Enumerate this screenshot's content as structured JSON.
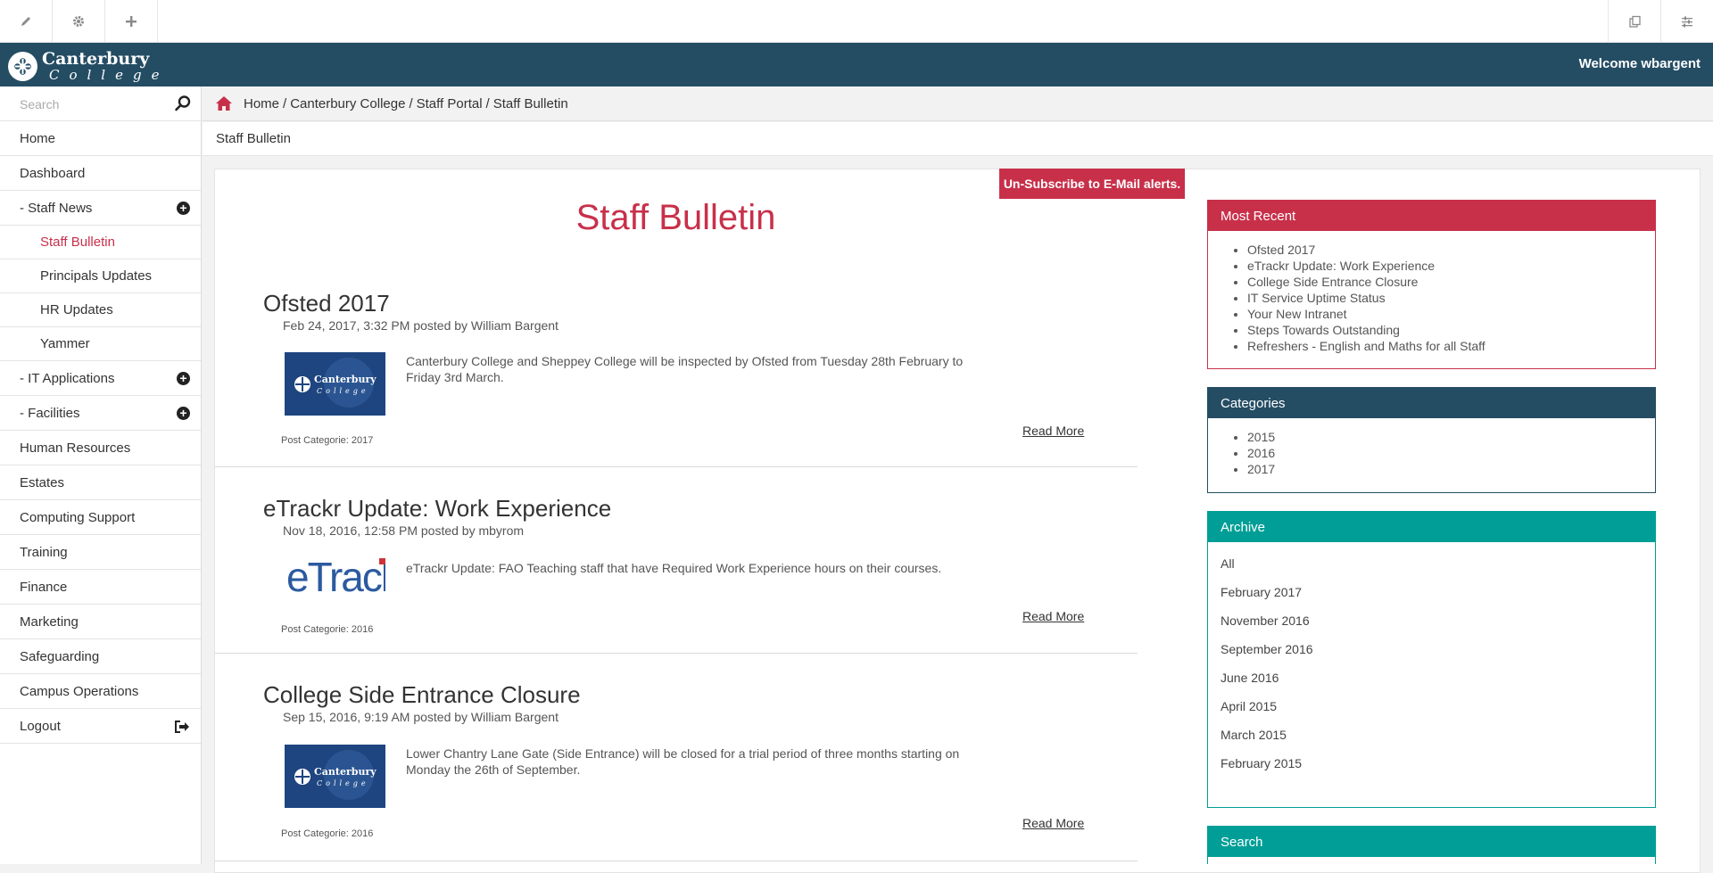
{
  "colors": {
    "header_bg": "#244d64",
    "accent_red": "#c8304a",
    "teal": "#009e96"
  },
  "toolbar": {
    "left_icons": [
      "pencil-icon",
      "gear-icon",
      "plus-icon"
    ],
    "right_icons": [
      "copy-icon",
      "sliders-icon"
    ]
  },
  "header": {
    "brand_line1": "Canterbury",
    "brand_line2": "College",
    "welcome": "Welcome wbargent"
  },
  "sidebar": {
    "search_placeholder": "Search",
    "items": [
      {
        "label": "Home"
      },
      {
        "label": "Dashboard"
      },
      {
        "label": "- Staff News"
      },
      {
        "label": "Staff Bulletin"
      },
      {
        "label": "Principals Updates"
      },
      {
        "label": "HR Updates"
      },
      {
        "label": "Yammer"
      },
      {
        "label": "- IT Applications"
      },
      {
        "label": "- Facilities"
      },
      {
        "label": "Human Resources"
      },
      {
        "label": "Estates"
      },
      {
        "label": "Computing Support"
      },
      {
        "label": "Training"
      },
      {
        "label": "Finance"
      },
      {
        "label": "Marketing"
      },
      {
        "label": "Safeguarding"
      },
      {
        "label": "Campus Operations"
      },
      {
        "label": "Logout"
      }
    ]
  },
  "breadcrumb": {
    "items": [
      "Home",
      "Canterbury College",
      "Staff Portal",
      "Staff Bulletin"
    ],
    "separator": "/"
  },
  "subtitle": "Staff Bulletin",
  "main": {
    "unsubscribe_label": "Un-Subscribe to E-Mail alerts.",
    "title": "Staff Bulletin",
    "read_more": "Read More",
    "posts": [
      {
        "title": "Ofsted 2017",
        "meta": "Feb 24, 2017, 3:32 PM posted by William Bargent",
        "excerpt": "Canterbury College and Sheppey College will be inspected by Ofsted from Tuesday 28th February to Friday 3rd March.",
        "category": "Post Categorie: 2017",
        "thumb": "canterbury-logo"
      },
      {
        "title": "eTrackr Update: Work Experience",
        "meta": "Nov 18, 2016, 12:58 PM posted by mbyrom",
        "excerpt": "eTrackr Update: FAO Teaching staff that have Required Work Experience hours on their courses.",
        "category": "Post Categorie: 2016",
        "thumb": "etrackr-logo",
        "thumb_text": "eTrackr"
      },
      {
        "title": "College Side Entrance Closure",
        "meta": "Sep 15, 2016, 9:19 AM posted by William Bargent",
        "excerpt": "Lower Chantry Lane Gate (Side Entrance) will be closed for a trial period of three months starting on Monday the 26th of September.",
        "category": "Post Categorie: 2016",
        "thumb": "canterbury-logo"
      }
    ]
  },
  "widgets": {
    "most_recent": {
      "title": "Most Recent",
      "items": [
        "Ofsted 2017",
        "eTrackr Update: Work Experience",
        "College Side Entrance Closure",
        "IT Service Uptime Status",
        "Your New Intranet",
        "Steps Towards Outstanding",
        "Refreshers - English and Maths for all Staff"
      ]
    },
    "categories": {
      "title": "Categories",
      "items": [
        "2015",
        "2016",
        "2017"
      ]
    },
    "archive": {
      "title": "Archive",
      "items": [
        "All",
        "February 2017",
        "November 2016",
        "September 2016",
        "June 2016",
        "April 2015",
        "March 2015",
        "February 2015"
      ]
    },
    "search": {
      "title": "Search"
    }
  }
}
